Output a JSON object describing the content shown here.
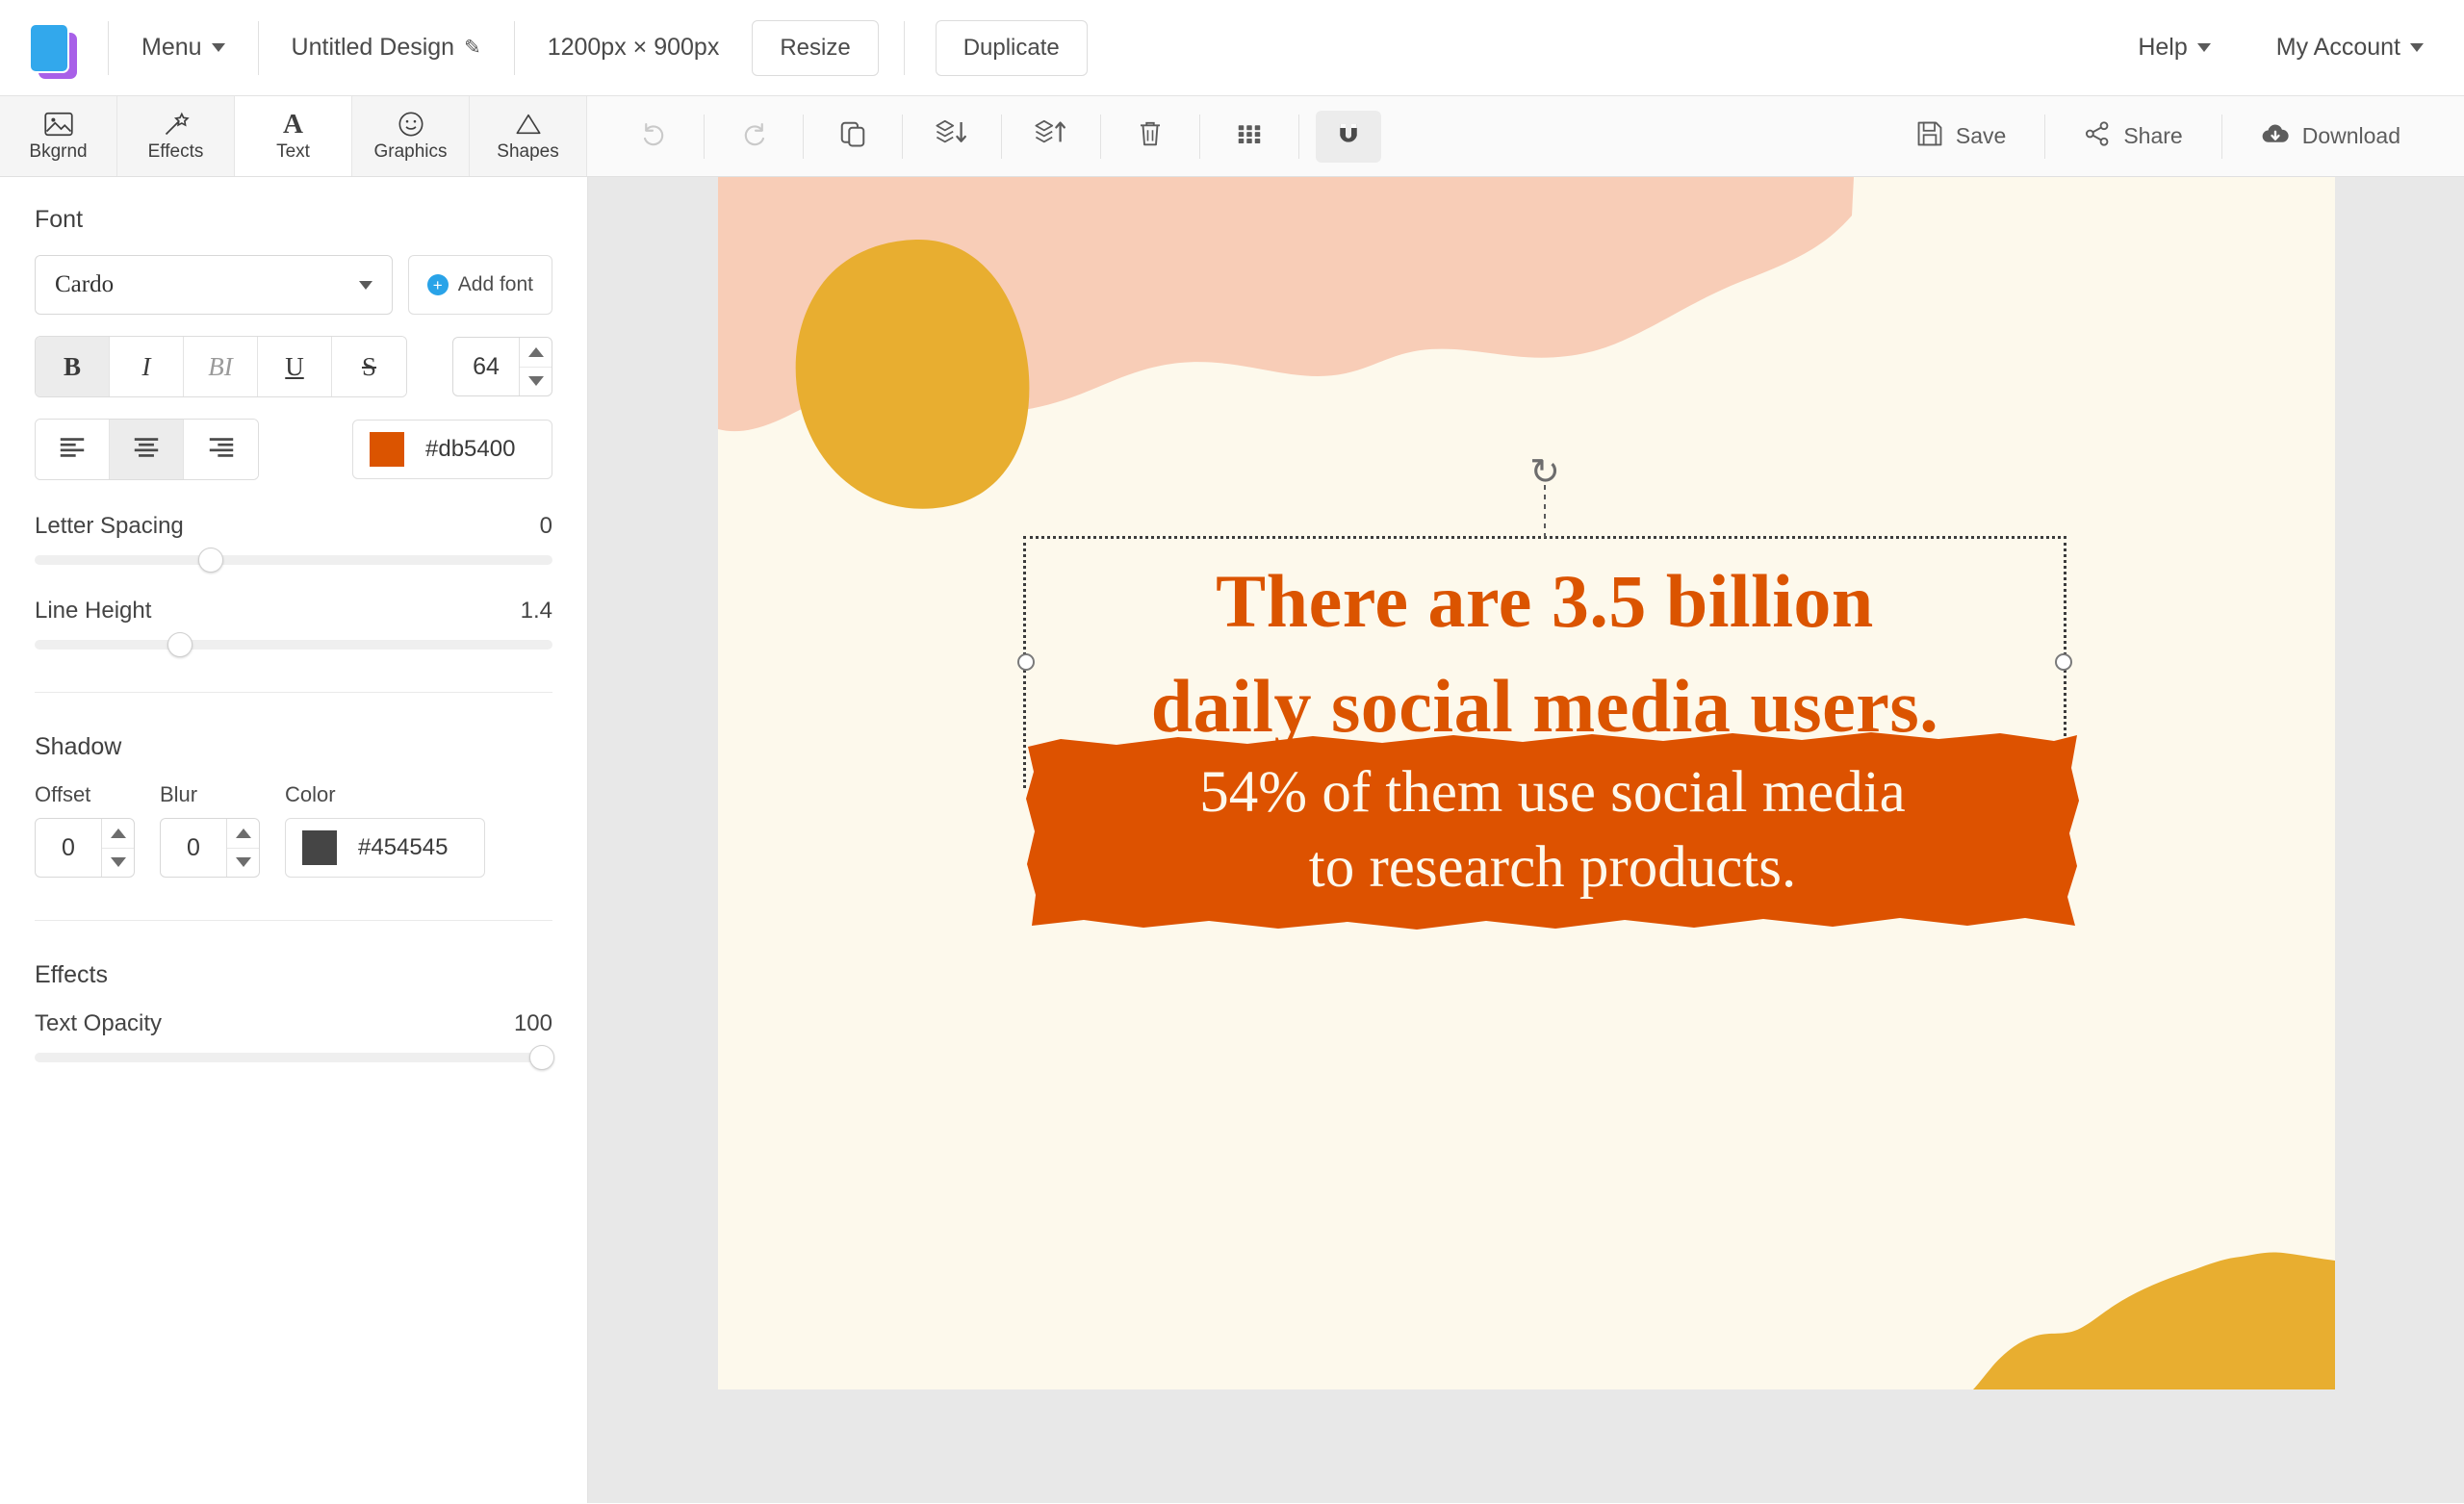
{
  "header": {
    "logo_icon": "stacked-squares-logo",
    "menu_label": "Menu",
    "design_title": "Untitled Design",
    "edit_title_icon": "pencil-icon",
    "dimensions": "1200px × 900px",
    "resize_label": "Resize",
    "duplicate_label": "Duplicate",
    "help_label": "Help",
    "account_label": "My Account"
  },
  "toolbar": {
    "tabs": [
      {
        "label": "Bkgrnd",
        "icon": "image-icon",
        "active": false
      },
      {
        "label": "Effects",
        "icon": "magic-wand-icon",
        "active": false
      },
      {
        "label": "Text",
        "icon": "letter-a-icon",
        "active": true
      },
      {
        "label": "Graphics",
        "icon": "smiley-icon",
        "active": false
      },
      {
        "label": "Shapes",
        "icon": "triangle-icon",
        "active": false
      }
    ],
    "tools": [
      {
        "name": "undo",
        "icon": "undo-arrow-icon",
        "state": "disabled"
      },
      {
        "name": "redo",
        "icon": "redo-arrow-icon",
        "state": "disabled"
      },
      {
        "name": "duplicate-layer",
        "icon": "copy-icon",
        "state": "enabled"
      },
      {
        "name": "send-backward",
        "icon": "layers-down-icon",
        "state": "enabled"
      },
      {
        "name": "bring-forward",
        "icon": "layers-up-icon",
        "state": "enabled"
      },
      {
        "name": "delete",
        "icon": "trash-icon",
        "state": "enabled"
      },
      {
        "name": "grid",
        "icon": "grid-dots-icon",
        "state": "enabled"
      },
      {
        "name": "snap",
        "icon": "magnet-icon",
        "state": "active"
      }
    ],
    "save_label": "Save",
    "share_label": "Share",
    "download_label": "Download"
  },
  "sidebar": {
    "font_section_title": "Font",
    "font_family": "Cardo",
    "add_font_label": "Add font",
    "style_buttons": [
      {
        "label": "B",
        "name": "bold",
        "active": true
      },
      {
        "label": "I",
        "name": "italic",
        "active": false
      },
      {
        "label": "BI",
        "name": "bold-italic",
        "active": false
      },
      {
        "label": "U",
        "name": "underline",
        "active": false
      },
      {
        "label": "S",
        "name": "strikethrough",
        "active": false
      }
    ],
    "font_size": "64",
    "align_buttons": [
      {
        "name": "align-left",
        "active": false
      },
      {
        "name": "align-center",
        "active": true
      },
      {
        "name": "align-right",
        "active": false
      }
    ],
    "text_color_hex": "#db5400",
    "letter_spacing_label": "Letter Spacing",
    "letter_spacing_value": "0",
    "letter_spacing_pct": 34,
    "line_height_label": "Line Height",
    "line_height_value": "1.4",
    "line_height_pct": 28,
    "shadow_section_title": "Shadow",
    "shadow_offset_label": "Offset",
    "shadow_offset_value": "0",
    "shadow_blur_label": "Blur",
    "shadow_blur_value": "0",
    "shadow_color_label": "Color",
    "shadow_color_hex": "#454545",
    "effects_section_title": "Effects",
    "text_opacity_label": "Text Opacity",
    "text_opacity_value": "100",
    "text_opacity_pct": 98
  },
  "canvas": {
    "background_color": "#fdf9ec",
    "stage_color": "#e8e8e8",
    "pink_shape_color": "#f8cdb7",
    "yellow_shape_color": "#e8ae30",
    "banner_color": "#dd5200",
    "heading_line_1": "There are 3.5 billion",
    "heading_line_2": "daily social media users.",
    "heading_color": "#db5400",
    "banner_line_1": "54% of them use social media",
    "banner_line_2": "to research products.",
    "banner_text_color": "#fdf9ec",
    "rotate_handle_icon": "rotate-icon"
  }
}
